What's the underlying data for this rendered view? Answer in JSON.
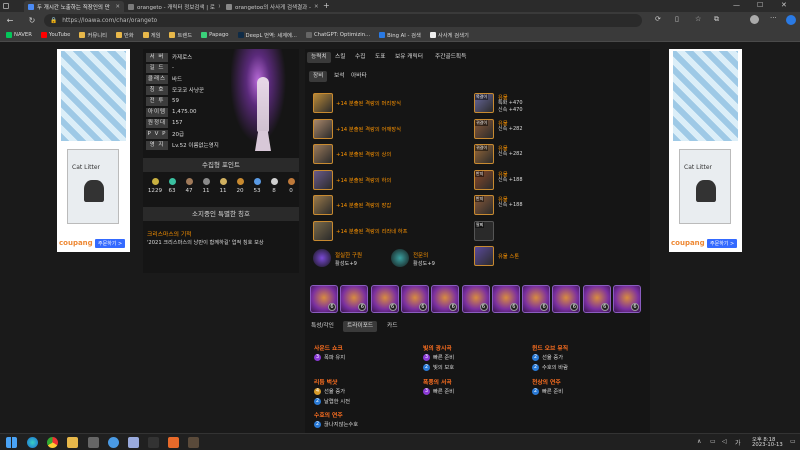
{
  "browser": {
    "tabs": [
      {
        "label": "두 개시간 노출하는 직장인의 만",
        "color": "#4b8bf5"
      },
      {
        "label": "orangeto - 캐릭터 정보검색 | 로",
        "color": "#7a7a7a"
      },
      {
        "label": "orangetoo의 사사게 검색결과 -",
        "color": "#888888"
      }
    ],
    "url": "https://loawa.com/char/orangeto",
    "bookmarks": [
      "NAVER",
      "YouTube",
      "커뮤니티",
      "만화",
      "게임",
      "트렌드",
      "Papago",
      "DeepL 번역: 세계에...",
      "ChatGPT: Optimizin...",
      "Bing AI - 검색",
      "사사게 검색기"
    ]
  },
  "ads": {
    "product_label": "Cat Litter",
    "brand": "coupang",
    "buy_label": "주문하기 >"
  },
  "character": {
    "info": [
      {
        "label": "서 버",
        "value": "카제로스"
      },
      {
        "label": "길 드",
        "value": "-"
      },
      {
        "label": "클래스",
        "value": "바드"
      },
      {
        "label": "칭 호",
        "value": "모코코 사냥꾼"
      },
      {
        "label": "전 투",
        "value": "59"
      },
      {
        "label": "아이템",
        "value": "1,475.00"
      },
      {
        "label": "원정대",
        "value": "157"
      },
      {
        "label": "P V P",
        "value": "20급"
      },
      {
        "label": "영 지",
        "value": "Lv.52 이름없는영지"
      }
    ],
    "collect_title": "수집형 포인트",
    "collect_values": [
      "1229",
      "63",
      "47",
      "11",
      "11",
      "20",
      "53",
      "8",
      "0"
    ],
    "title_section": "소지중인 특별한 칭호",
    "special_title_name": "크리스마스의 기적",
    "special_title_desc": "'2021 크리스마스의 낭만이 함께하길' 업적 칭호 보상"
  },
  "tabs_top": [
    "능력치",
    "스킬",
    "수집",
    "도표",
    "보유 캐릭터",
    "주간골드획득"
  ],
  "tabs_sub": [
    "장비",
    "보석",
    "아바타"
  ],
  "equipment": [
    {
      "grade": "+14",
      "name": "+14 분출된 격랑의 머리장식",
      "icon_color": "#b98a3a"
    },
    {
      "grade": "+14",
      "name": "+14 분출된 격랑의 어깨장식",
      "icon_color": "#a8876a"
    },
    {
      "grade": "+14",
      "name": "+14 분출된 격랑의 상의",
      "icon_color": "#9a7a5a"
    },
    {
      "grade": "+14",
      "name": "+14 분출된 격랑의 하의",
      "icon_color": "#6a5a8a"
    },
    {
      "grade": "+14",
      "name": "+14 분출된 격랑의 장갑",
      "icon_color": "#9a7a4a"
    },
    {
      "grade": "+14",
      "name": "+14 분출된 격랑의 리라네 하프",
      "icon_color": "#7a6a4a"
    }
  ],
  "accessories": [
    {
      "tag": "목걸이",
      "name": "유물",
      "stats": [
        "특화 +470",
        "신속 +470"
      ],
      "icon_color": "#6a6aa0"
    },
    {
      "tag": "귀걸이",
      "name": "유물",
      "stats": [
        "신속 +282"
      ],
      "icon_color": "#8a5a3a"
    },
    {
      "tag": "귀걸이",
      "name": "유물",
      "stats": [
        "신속 +282"
      ],
      "icon_color": "#9a6a3a"
    },
    {
      "tag": "반지",
      "name": "유물",
      "stats": [
        "신속 +188"
      ],
      "icon_color": "#8a4a2a"
    },
    {
      "tag": "반지",
      "name": "유물",
      "stats": [
        "신속 +188"
      ],
      "icon_color": "#8a5a3a"
    },
    {
      "tag": "팔찌",
      "name": "",
      "stats": [],
      "icon_color": "#2a2a2a"
    },
    {
      "tag": "",
      "name": "유물 스톤",
      "stats": [],
      "icon_color": "#5a4a9a"
    }
  ],
  "bracelet_gems": [
    {
      "name": "절실한 구원",
      "level": "활성도+9"
    },
    {
      "name": "전문의",
      "level": "활성도+9"
    }
  ],
  "cards": [
    "6",
    "6",
    "6",
    "6",
    "6",
    "6",
    "6",
    "6",
    "6",
    "6",
    "6"
  ],
  "tabs_bottom": [
    "특성/각인",
    "트라이포드",
    "카드"
  ],
  "engravings": [
    {
      "name": "사운드 쇼크",
      "effects": [
        {
          "lv": "3",
          "text": "폭파 유지",
          "color": "#8a3ad6"
        }
      ]
    },
    {
      "name": "빛의 광시곡",
      "effects": [
        {
          "lv": "3",
          "text": "빠른 준비",
          "color": "#8a3ad6"
        },
        {
          "lv": "2",
          "text": "빛의 보호",
          "color": "#2a7ad6"
        }
      ]
    },
    {
      "name": "윈드 오브 뮤직",
      "effects": [
        {
          "lv": "2",
          "text": "선율 증가",
          "color": "#2a7ad6"
        },
        {
          "lv": "2",
          "text": "수호의 바람",
          "color": "#2a7ad6"
        }
      ]
    },
    {
      "name": "리듬 벅샷",
      "effects": [
        {
          "lv": "4",
          "text": "선율 증가",
          "color": "#d69a2a"
        },
        {
          "lv": "2",
          "text": "날렵한 시전",
          "color": "#2a7ad6"
        }
      ]
    },
    {
      "name": "폭풍의 서곡",
      "effects": [
        {
          "lv": "3",
          "text": "빠른 준비",
          "color": "#8a3ad6"
        }
      ]
    },
    {
      "name": "천상의 연주",
      "effects": [
        {
          "lv": "2",
          "text": "빠른 준비",
          "color": "#2a7ad6"
        }
      ]
    },
    {
      "name": "수호의 연주",
      "effects": [
        {
          "lv": "2",
          "text": "끊나지않는수호",
          "color": "#2a7ad6"
        }
      ]
    }
  ],
  "clock": {
    "time": "오후 8:18",
    "date": "2023-10-13"
  }
}
